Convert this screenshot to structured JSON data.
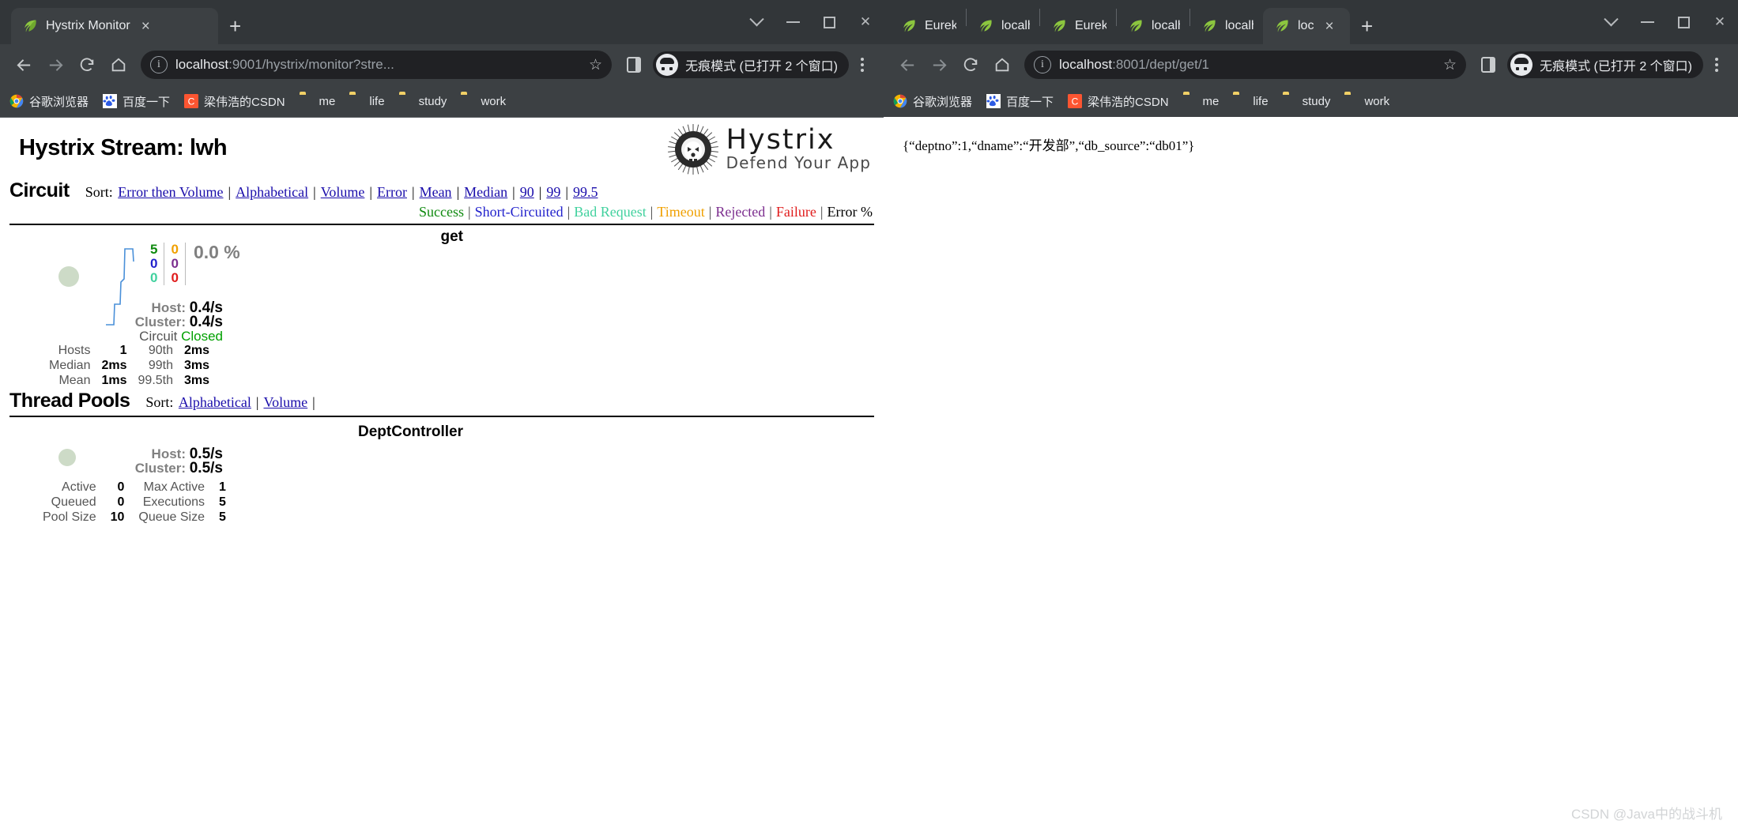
{
  "left_window": {
    "tabs": [
      {
        "title": "Hystrix Monitor",
        "icon": "spring-leaf-icon",
        "active": true,
        "close_label": "×"
      }
    ],
    "new_tab_label": "+",
    "window_controls": {
      "expand": "chevron-down-icon",
      "minimize": "minimize-icon",
      "maximize": "maximize-icon",
      "close": "close-icon"
    },
    "toolbar": {
      "back": "back-arrow-icon",
      "forward": "forward-arrow-icon",
      "reload": "reload-icon",
      "home": "home-icon",
      "url_secure_prefix": "localhost",
      "url_rest": ":9001/hystrix/monitor?stre...",
      "bookmark_star": "☆",
      "side_panel": "side-panel-icon",
      "incognito_label": "无痕模式 (已打开 2 个窗口)",
      "menu": "kebab-menu-icon"
    },
    "bookmarks": [
      {
        "label": "谷歌浏览器",
        "icon": "chrome-icon"
      },
      {
        "label": "百度一下",
        "icon": "baidu-icon"
      },
      {
        "label": "梁伟浩的CSDN",
        "icon": "csdn-icon"
      },
      {
        "label": "me",
        "icon": "folder-icon"
      },
      {
        "label": "life",
        "icon": "folder-icon"
      },
      {
        "label": "study",
        "icon": "folder-icon"
      },
      {
        "label": "work",
        "icon": "folder-icon"
      }
    ]
  },
  "right_window": {
    "tabs": [
      {
        "title": "Eureka",
        "icon": "spring-leaf-icon",
        "active": false
      },
      {
        "title": "localh",
        "icon": "spring-leaf-icon",
        "active": false
      },
      {
        "title": "Eureka",
        "icon": "spring-leaf-icon",
        "active": false
      },
      {
        "title": "localh",
        "icon": "spring-leaf-icon",
        "active": false
      },
      {
        "title": "localh",
        "icon": "spring-leaf-icon",
        "active": false
      },
      {
        "title": "loc",
        "icon": "spring-leaf-icon",
        "active": true,
        "close_label": "×"
      }
    ],
    "new_tab_label": "+",
    "window_controls": {
      "expand": "chevron-down-icon",
      "minimize": "minimize-icon",
      "maximize": "maximize-icon",
      "close": "close-icon"
    },
    "toolbar": {
      "url_secure_prefix": "localhost",
      "url_rest": ":8001/dept/get/1",
      "bookmark_star": "☆",
      "incognito_label": "无痕模式 (已打开 2 个窗口)"
    },
    "bookmarks": [
      {
        "label": "谷歌浏览器",
        "icon": "chrome-icon"
      },
      {
        "label": "百度一下",
        "icon": "baidu-icon"
      },
      {
        "label": "梁伟浩的CSDN",
        "icon": "csdn-icon"
      },
      {
        "label": "me",
        "icon": "folder-icon"
      },
      {
        "label": "life",
        "icon": "folder-icon"
      },
      {
        "label": "study",
        "icon": "folder-icon"
      },
      {
        "label": "work",
        "icon": "folder-icon"
      }
    ],
    "page": {
      "json_response": "{“deptno”:1,“dname”:“开发部”,“db_source”:“db01”}"
    }
  },
  "hystrix": {
    "stream_title": "Hystrix Stream: lwh",
    "brand": "Hystrix",
    "tagline": "Defend Your App",
    "circuit": {
      "heading": "Circuit",
      "sort_label": "Sort:",
      "sort_links": [
        "Error then Volume",
        "Alphabetical",
        "Volume",
        "Error",
        "Mean",
        "Median",
        "90",
        "99",
        "99.5"
      ],
      "legend": [
        {
          "label": "Success",
          "color": "#0f8a0f"
        },
        {
          "label": "Short-Circuited",
          "color": "#2222cc"
        },
        {
          "label": "Bad Request",
          "color": "#41d19e"
        },
        {
          "label": "Timeout",
          "color": "#f0a000"
        },
        {
          "label": "Rejected",
          "color": "#7b2d8e"
        },
        {
          "label": "Failure",
          "color": "#e01b1b"
        },
        {
          "label": "Error %",
          "color": "#000000"
        }
      ],
      "cards": [
        {
          "name": "get",
          "counters": {
            "success": "5",
            "timeout": "0",
            "short_circuited": "0",
            "rejected": "0",
            "bad_request": "0",
            "failure": "0"
          },
          "error_percent": "0.0 %",
          "host_label": "Host:",
          "host_rate": "0.4/s",
          "cluster_label": "Cluster:",
          "cluster_rate": "0.4/s",
          "circuit_label": "Circuit",
          "circuit_state": "Closed",
          "stats": [
            {
              "label": "Hosts",
              "value": "1",
              "label2": "90th",
              "value2": "2ms"
            },
            {
              "label": "Median",
              "value": "2ms",
              "label2": "99th",
              "value2": "3ms"
            },
            {
              "label": "Mean",
              "value": "1ms",
              "label2": "99.5th",
              "value2": "3ms"
            }
          ]
        }
      ]
    },
    "thread_pools": {
      "heading": "Thread Pools",
      "sort_label": "Sort:",
      "sort_links": [
        "Alphabetical",
        "Volume"
      ],
      "cards": [
        {
          "name": "DeptController",
          "host_label": "Host:",
          "host_rate": "0.5/s",
          "cluster_label": "Cluster:",
          "cluster_rate": "0.5/s",
          "stats": [
            {
              "label": "Active",
              "value": "0",
              "label2": "Max Active",
              "value2": "1"
            },
            {
              "label": "Queued",
              "value": "0",
              "label2": "Executions",
              "value2": "5"
            },
            {
              "label": "Pool Size",
              "value": "10",
              "label2": "Queue Size",
              "value2": "5"
            }
          ]
        }
      ]
    }
  },
  "watermark": "CSDN @Java中的战斗机"
}
